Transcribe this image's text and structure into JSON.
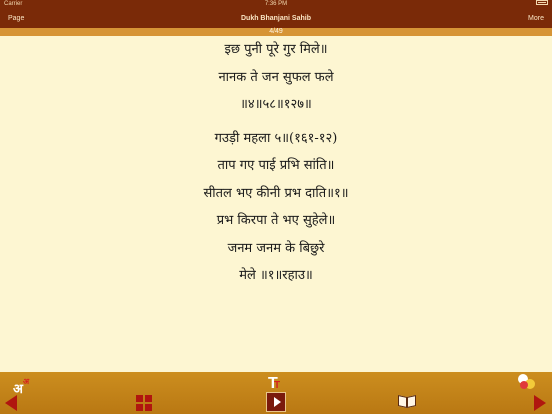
{
  "status_bar": {
    "carrier": "Carrier",
    "time": "7:36 PM"
  },
  "nav": {
    "left": "Page",
    "title": "Dukh Bhanjani Sahib",
    "right": "More"
  },
  "progress": {
    "label": "4/49"
  },
  "verses": [
    "इछ पुनी पूरे गुर मिले॥",
    "नानक ते जन सुफल फले",
    "॥४॥५८॥१२७॥",
    "गउड़ी महला ५॥(१६१-१२)",
    "ताप गए पाई प्रभि सांति॥",
    "सीतल भए कीनी प्रभ दाति॥१॥",
    "प्रभ किरपा ते भए सुहेले॥",
    "जनम जनम के बिछुरे",
    "मेले ॥१॥रहाउ॥"
  ],
  "toolbar": {
    "font_script": {
      "big": "अ",
      "small": "अ"
    },
    "text_size": {
      "big": "T",
      "small": "T"
    }
  },
  "icons": {
    "prev": "triangle-left",
    "next": "triangle-right",
    "grid": "grid-squares",
    "play": "play-button",
    "book": "open-book",
    "theme": "color-circles"
  },
  "colors": {
    "header_bg": "#7a2a08",
    "progress_bg": "#d69436",
    "page_bg": "#fdf6d2",
    "toolbar_bg": "#c4841a",
    "accent_red": "#b0160f"
  }
}
